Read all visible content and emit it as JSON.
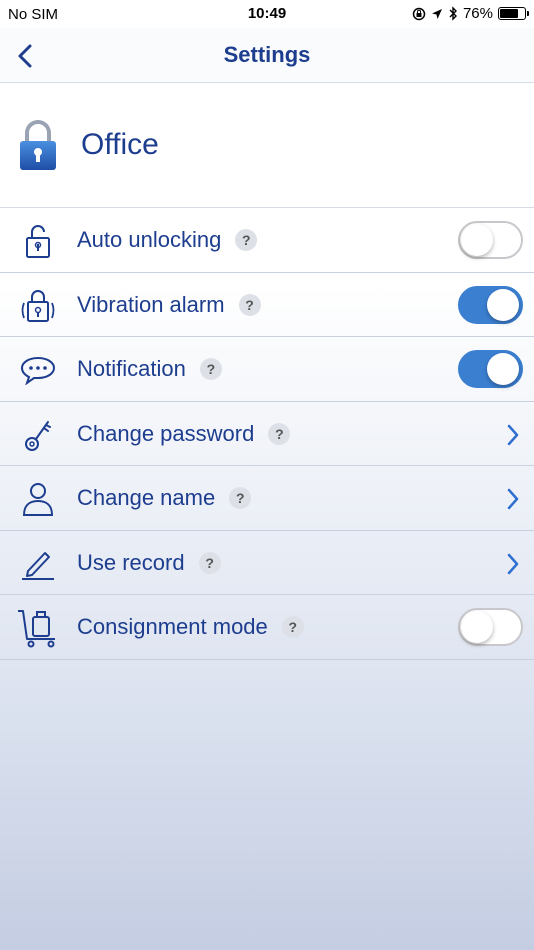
{
  "status_bar": {
    "carrier": "No SIM",
    "time": "10:49",
    "battery_percent": "76%",
    "battery_level": 0.76
  },
  "nav": {
    "title": "Settings",
    "back_icon": "chevron-left-icon"
  },
  "device": {
    "name": "Office",
    "icon": "padlock-icon"
  },
  "help_symbol": "?",
  "rows": [
    {
      "label": "Auto unlocking",
      "icon": "lock-outline-icon",
      "control": "toggle",
      "on": false
    },
    {
      "label": "Vibration alarm",
      "icon": "vibrating-lock-icon",
      "control": "toggle",
      "on": true
    },
    {
      "label": "Notification",
      "icon": "speech-bubble-icon",
      "control": "toggle",
      "on": true
    },
    {
      "label": "Change password",
      "icon": "key-icon",
      "control": "chevron"
    },
    {
      "label": "Change name",
      "icon": "person-icon",
      "control": "chevron"
    },
    {
      "label": "Use record",
      "icon": "pencil-icon",
      "control": "chevron"
    },
    {
      "label": "Consignment mode",
      "icon": "luggage-cart-icon",
      "control": "toggle",
      "on": false
    }
  ],
  "colors": {
    "accent": "#3b7fd1",
    "text": "#1d3d8f"
  }
}
